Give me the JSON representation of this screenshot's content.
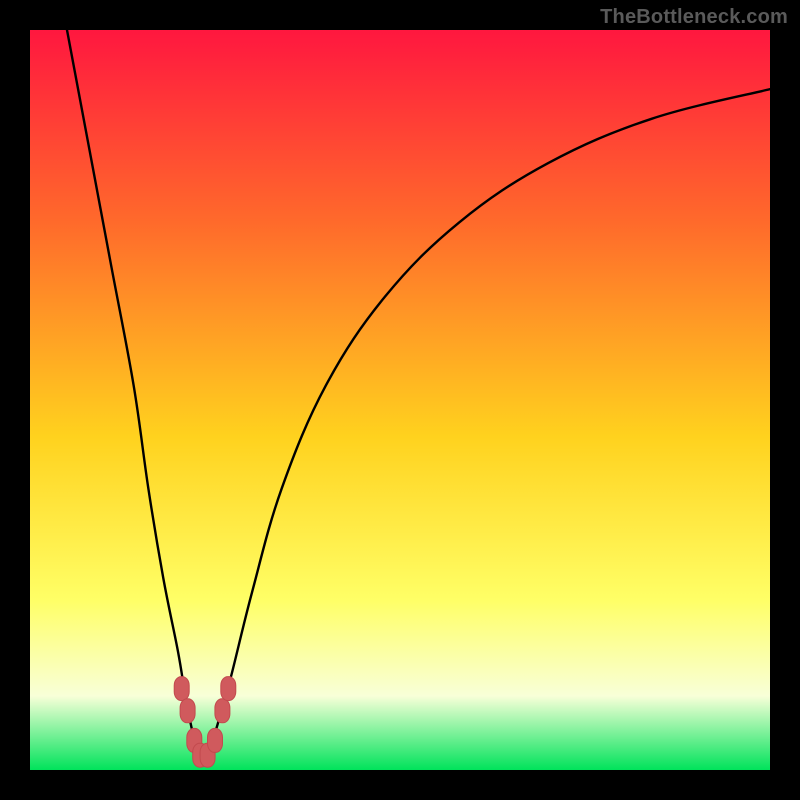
{
  "watermark": "TheBottleneck.com",
  "colors": {
    "frame": "#000000",
    "gradient_top": "#ff173f",
    "gradient_mid_upper": "#ff6a2b",
    "gradient_mid": "#ffd21e",
    "gradient_mid_lower": "#ffff66",
    "gradient_pale": "#f8ffd8",
    "gradient_bottom": "#00e35b",
    "curve": "#000000",
    "marker_fill": "#d05a5d",
    "marker_stroke": "#c24a4e"
  },
  "chart_data": {
    "type": "line",
    "title": "",
    "xlabel": "",
    "ylabel": "",
    "xlim": [
      0,
      100
    ],
    "ylim": [
      0,
      100
    ],
    "note": "Axes unlabeled in source image; x normalized 0–100 left→right, y = bottleneck magnitude 0 (bottom, green, balanced) to 100 (top, red, severe).",
    "series": [
      {
        "name": "bottleneck-curve",
        "x": [
          5,
          8,
          11,
          14,
          16,
          18,
          20,
          21,
          22,
          23,
          24,
          25,
          27,
          30,
          34,
          40,
          48,
          58,
          70,
          84,
          100
        ],
        "y": [
          100,
          84,
          68,
          52,
          38,
          26,
          16,
          10,
          5,
          2,
          2,
          5,
          12,
          24,
          38,
          52,
          64,
          74,
          82,
          88,
          92
        ]
      }
    ],
    "markers": {
      "name": "highlighted-points",
      "x": [
        20.5,
        21.3,
        22.2,
        23.0,
        24.0,
        25.0,
        26.0,
        26.8
      ],
      "y": [
        11,
        8,
        4,
        2,
        2,
        4,
        8,
        11
      ]
    },
    "minimum_at_x": 23.5
  }
}
